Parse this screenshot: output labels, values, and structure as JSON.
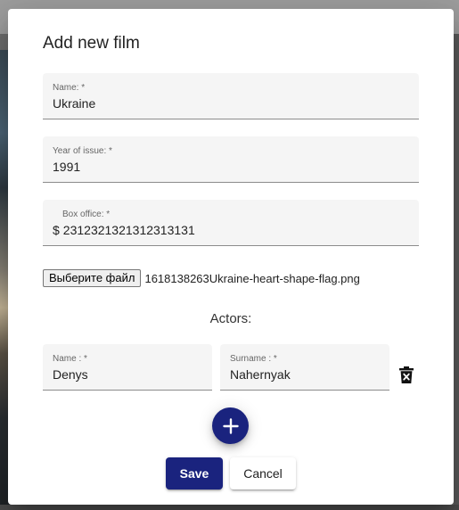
{
  "dialog": {
    "title": "Add new film",
    "fields": {
      "name": {
        "label": "Name: *",
        "value": "Ukraine"
      },
      "year": {
        "label": "Year of issue: *",
        "value": "1991"
      },
      "box_office": {
        "label": "Box office: *",
        "prefix": "$",
        "value": "2312321321312313131"
      }
    },
    "file": {
      "button_label": "Выберите файл",
      "file_name": "1618138263Ukraine-heart-shape-flag.png"
    },
    "actors": {
      "heading": "Actors:",
      "items": [
        {
          "name_label": "Name : *",
          "name_value": "Denys",
          "surname_label": "Surname : *",
          "surname_value": "Nahernyak"
        }
      ]
    },
    "icons": {
      "delete": "delete-icon",
      "add": "plus-icon"
    },
    "buttons": {
      "save": "Save",
      "cancel": "Cancel"
    },
    "colors": {
      "primary": "#1a237e",
      "field_background": "#f5f5f5"
    }
  }
}
